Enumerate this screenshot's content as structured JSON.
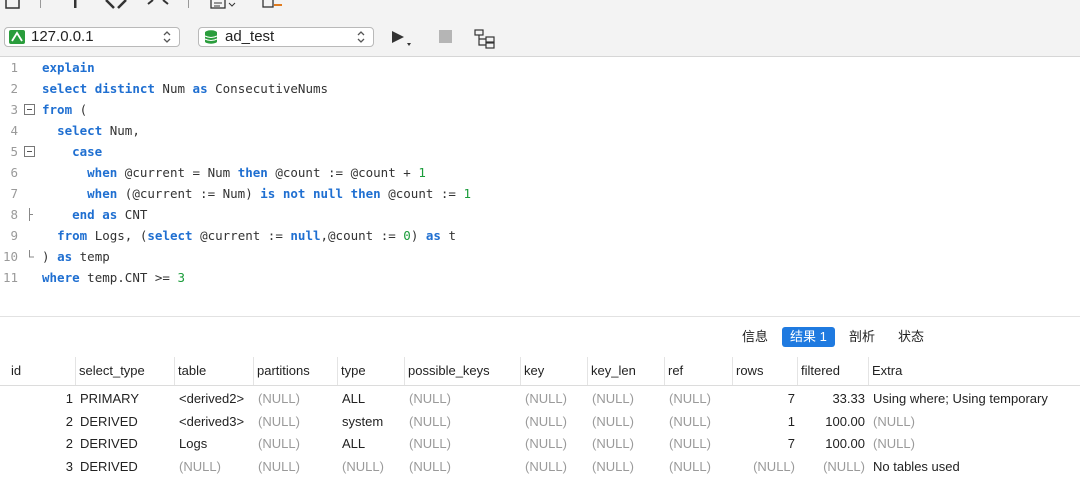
{
  "toolbar": {
    "connection": "127.0.0.1",
    "database": "ad_test"
  },
  "editor": {
    "lines": [
      {
        "n": "1",
        "fold": "none",
        "indent": 0,
        "tokens": [
          [
            "kw",
            "explain"
          ]
        ]
      },
      {
        "n": "2",
        "fold": "none",
        "indent": 0,
        "tokens": [
          [
            "kw",
            "select"
          ],
          [
            "t",
            " "
          ],
          [
            "kw",
            "distinct"
          ],
          [
            "t",
            " Num "
          ],
          [
            "kw",
            "as"
          ],
          [
            "t",
            " ConsecutiveNums"
          ]
        ]
      },
      {
        "n": "3",
        "fold": "open",
        "indent": 0,
        "tokens": [
          [
            "kw",
            "from"
          ],
          [
            "t",
            " ("
          ]
        ]
      },
      {
        "n": "4",
        "fold": "none",
        "indent": 2,
        "tokens": [
          [
            "kw",
            "select"
          ],
          [
            "t",
            " Num,"
          ]
        ]
      },
      {
        "n": "5",
        "fold": "open",
        "indent": 4,
        "tokens": [
          [
            "kw",
            "case"
          ]
        ]
      },
      {
        "n": "6",
        "fold": "none",
        "indent": 6,
        "tokens": [
          [
            "kw",
            "when"
          ],
          [
            "t",
            " @current = Num "
          ],
          [
            "kw",
            "then"
          ],
          [
            "t",
            " @count := @count + "
          ],
          [
            "num",
            "1"
          ]
        ]
      },
      {
        "n": "7",
        "fold": "none",
        "indent": 6,
        "tokens": [
          [
            "kw",
            "when"
          ],
          [
            "t",
            " (@current := Num) "
          ],
          [
            "kw",
            "is not null"
          ],
          [
            "t",
            " "
          ],
          [
            "kw",
            "then"
          ],
          [
            "t",
            " @count := "
          ],
          [
            "num",
            "1"
          ]
        ]
      },
      {
        "n": "8",
        "fold": "mid",
        "indent": 4,
        "tokens": [
          [
            "kw",
            "end"
          ],
          [
            "t",
            " "
          ],
          [
            "kw",
            "as"
          ],
          [
            "t",
            " CNT"
          ]
        ]
      },
      {
        "n": "9",
        "fold": "none",
        "indent": 2,
        "tokens": [
          [
            "kw",
            "from"
          ],
          [
            "t",
            " Logs, ("
          ],
          [
            "kw",
            "select"
          ],
          [
            "t",
            " @current := "
          ],
          [
            "kw",
            "null"
          ],
          [
            "t",
            ",@count := "
          ],
          [
            "num",
            "0"
          ],
          [
            "t",
            ") "
          ],
          [
            "kw",
            "as"
          ],
          [
            "t",
            " t"
          ]
        ]
      },
      {
        "n": "10",
        "fold": "end",
        "indent": 0,
        "tokens": [
          [
            "t",
            ") "
          ],
          [
            "kw",
            "as"
          ],
          [
            "t",
            " temp"
          ]
        ]
      },
      {
        "n": "11",
        "fold": "none",
        "indent": 0,
        "tokens": [
          [
            "kw",
            "where"
          ],
          [
            "t",
            " temp.CNT >= "
          ],
          [
            "num",
            "3"
          ]
        ]
      }
    ]
  },
  "result_tabs": [
    {
      "label": "信息",
      "active": false
    },
    {
      "label": "结果 1",
      "active": true
    },
    {
      "label": "剖析",
      "active": false
    },
    {
      "label": "状态",
      "active": false
    }
  ],
  "grid": {
    "columns": [
      "id",
      "select_type",
      "table",
      "partitions",
      "type",
      "possible_keys",
      "key",
      "key_len",
      "ref",
      "rows",
      "filtered",
      "Extra"
    ],
    "rows": [
      [
        "1",
        "PRIMARY",
        "<derived2>",
        "(NULL)",
        "ALL",
        "(NULL)",
        "(NULL)",
        "(NULL)",
        "(NULL)",
        "7",
        "33.33",
        "Using where; Using temporary"
      ],
      [
        "2",
        "DERIVED",
        "<derived3>",
        "(NULL)",
        "system",
        "(NULL)",
        "(NULL)",
        "(NULL)",
        "(NULL)",
        "1",
        "100.00",
        "(NULL)"
      ],
      [
        "2",
        "DERIVED",
        "Logs",
        "(NULL)",
        "ALL",
        "(NULL)",
        "(NULL)",
        "(NULL)",
        "(NULL)",
        "7",
        "100.00",
        "(NULL)"
      ],
      [
        "3",
        "DERIVED",
        "(NULL)",
        "(NULL)",
        "(NULL)",
        "(NULL)",
        "(NULL)",
        "(NULL)",
        "(NULL)",
        "(NULL)",
        "(NULL)",
        "No tables used"
      ]
    ]
  },
  "colors": {
    "keyword": "#1f6fd1",
    "number": "#1a9c3a",
    "null": "#9a9a9a",
    "accent": "#1f7ae0"
  }
}
